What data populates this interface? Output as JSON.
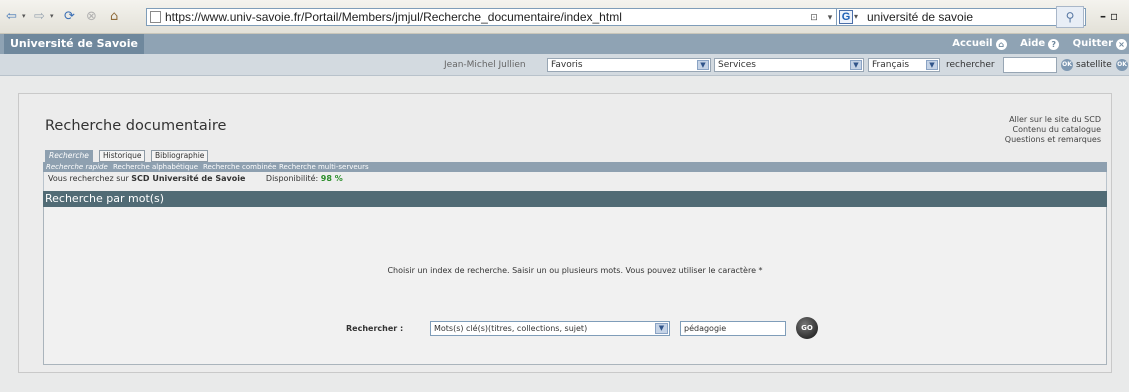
{
  "browser": {
    "url": "https://www.univ-savoie.fr/Portail/Members/jmjul/Recherche_documentaire/index_html",
    "search_query": "université de savoie",
    "search_engine": "G"
  },
  "site": {
    "title": "Université de Savoie",
    "links": {
      "accueil": "Accueil",
      "aide": "Aide",
      "quitter": "Quitter"
    }
  },
  "toolbar": {
    "user": "Jean-Michel Jullien",
    "favoris": "Favoris",
    "services": "Services",
    "language": "Français",
    "search_label": "rechercher",
    "ok_label": "OK",
    "satellite_label": "satellite"
  },
  "main": {
    "page_title": "Recherche documentaire",
    "right_links": [
      "Aller sur le site du SCD",
      "Contenu du catalogue",
      "Questions et remarques"
    ],
    "tabs": [
      {
        "label": "Recherche"
      },
      {
        "label": "Historique"
      },
      {
        "label": "Bibliographie"
      }
    ],
    "subtabs": [
      {
        "label": "Recherche rapide"
      },
      {
        "label": "Recherche alphabétique"
      },
      {
        "label": "Recherche combinée"
      },
      {
        "label": "Recherche multi-serveurs"
      }
    ],
    "info_prefix": "Vous recherchez sur",
    "info_source": "SCD Université de Savoie",
    "availability_label": "Disponibilité:",
    "availability_value": "98 %",
    "section_title": "Recherche par mot(s)",
    "instruction": "Choisir un index de recherche. Saisir un ou plusieurs mots. Vous pouvez utiliser le caractère *",
    "search_label": "Rechercher :",
    "index_selected": "Mots(s) clé(s)(titres, collections, sujet)",
    "keyword_value": "pédagogie",
    "go_label": "GO"
  }
}
